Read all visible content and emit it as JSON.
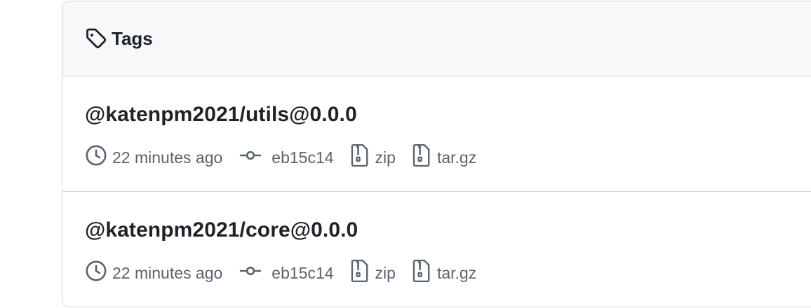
{
  "header": {
    "title": "Tags",
    "icon": "tag-icon"
  },
  "tags": [
    {
      "name": "@katenpm2021/utils@0.0.0",
      "time": "22 minutes ago",
      "commit": "eb15c14",
      "zip_label": "zip",
      "tar_label": "tar.gz"
    },
    {
      "name": "@katenpm2021/core@0.0.0",
      "time": "22 minutes ago",
      "commit": "eb15c14",
      "zip_label": "zip",
      "tar_label": "tar.gz"
    }
  ],
  "icons": {
    "time": "clock-icon",
    "commit": "git-commit-icon",
    "zip": "file-zip-icon",
    "tar": "file-zip-icon"
  },
  "colors": {
    "border": "#d0d7de",
    "header_bg": "#f6f8fa",
    "text": "#1f2328",
    "muted": "#59636e"
  }
}
